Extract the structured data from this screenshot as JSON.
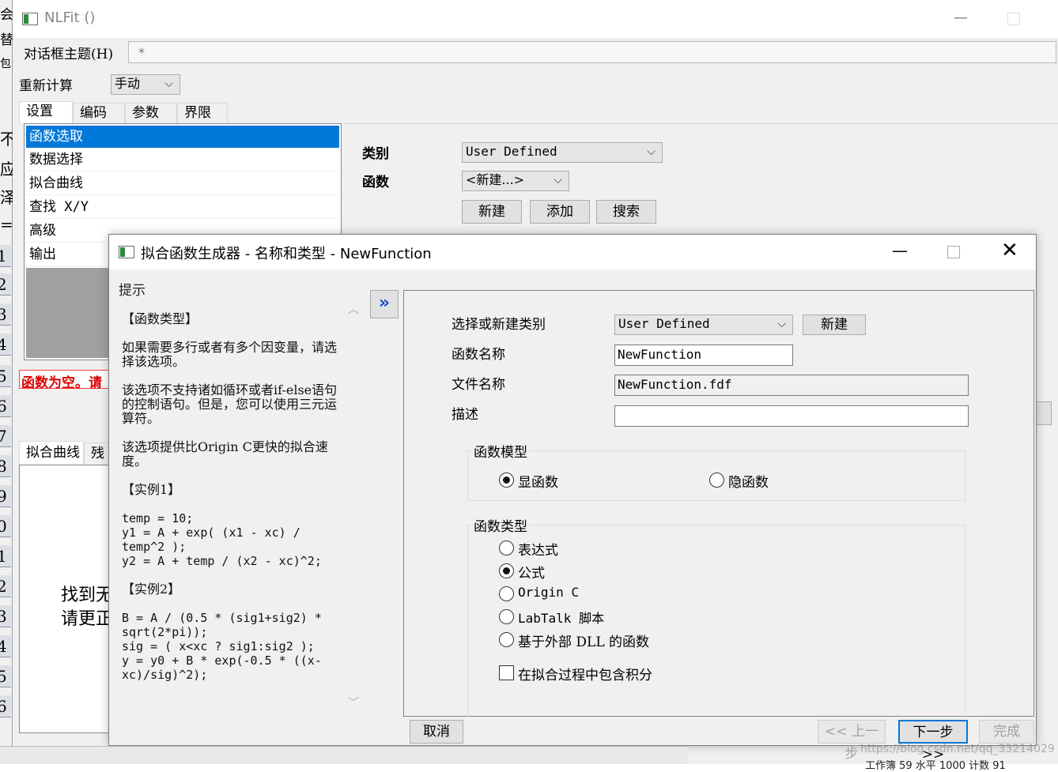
{
  "left_strip": {
    "top_chars": [
      "会",
      "替",
      "包"
    ],
    "side_chars": [
      "不",
      "应",
      "泽",
      "="
    ],
    "numbers": [
      "1",
      "2",
      "3",
      "4",
      "5",
      "6",
      "7",
      "8",
      "9",
      "0",
      "1",
      "2",
      "3",
      "4",
      "5",
      "6"
    ]
  },
  "nlfit": {
    "title": "NLFit ()",
    "theme_label": "对话框主题(H)",
    "theme_value": "*",
    "recalc_label": "重新计算",
    "recalc_value": "手动",
    "tabs": [
      "设置",
      "编码",
      "参数",
      "界限"
    ],
    "nav_items": [
      "函数选取",
      "数据选择",
      "拟合曲线",
      "查找 X/Y",
      "高级",
      "输出"
    ],
    "error_text": "函数为空。请",
    "category_label": "类别",
    "category_value": "User Defined",
    "function_label": "函数",
    "function_value": "<新建...>",
    "buttons": {
      "new": "新建",
      "add": "添加",
      "search": "搜索"
    },
    "bottom_tabs": [
      "拟合曲线",
      "残差"
    ],
    "preview_text_1": "找到无",
    "preview_text_2": "请更正"
  },
  "dialog": {
    "title": "拟合函数生成器 - 名称和类型 - NewFunction",
    "hint_caption": "提示",
    "hint": {
      "h1": "【函数类型】",
      "p1": "如果需要多行或者有多个因变量，请选择该选项。",
      "p2": "该选项不支持诸如循环或者if-else语句的控制语句。但是，您可以使用三元运算符。",
      "p3": "该选项提供比Origin C更快的拟合速度。",
      "h2": "【实例1】",
      "code1": "temp = 10;\ny1 = A + exp( (x1 - xc) /\ntemp^2 );\ny2 = A + temp / (x2 - xc)^2;",
      "h3": "【实例2】",
      "code2": "B = A / (0.5 * (sig1+sig2) *\nsqrt(2*pi));\nsig = ( x<xc ? sig1:sig2 );\ny = y0 + B * exp(-0.5 * ((x-\nxc)/sig)^2);"
    },
    "form": {
      "category_label": "选择或新建类别",
      "category_value": "User Defined",
      "category_new": "新建",
      "name_label": "函数名称",
      "name_value": "NewFunction",
      "file_label": "文件名称",
      "file_value": "NewFunction.fdf",
      "desc_label": "描述",
      "desc_value": "",
      "model_group": "函数模型",
      "model_options": [
        "显函数",
        "隐函数"
      ],
      "model_selected": "显函数",
      "type_group": "函数类型",
      "type_options": [
        "表达式",
        "公式",
        "Origin C",
        "LabTalk 脚本",
        "基于外部 DLL 的函数"
      ],
      "type_selected": "公式",
      "integral_label": "在拟合过程中包含积分",
      "integral_checked": false
    },
    "buttons": {
      "cancel": "取消",
      "prev": "<< 上一步",
      "next": "下一步 >>",
      "finish": "完成"
    }
  },
  "watermark": "https://blog.csdn.net/qq_33214029",
  "status_text": "工作簿  59  水平  1000  计数  91"
}
